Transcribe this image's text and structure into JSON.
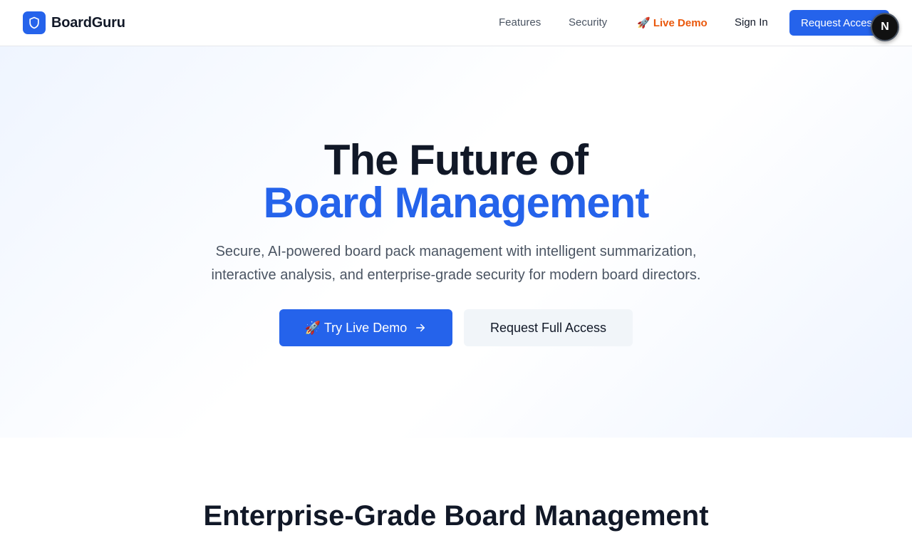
{
  "nav": {
    "brand": "BoardGuru",
    "links": {
      "features": "Features",
      "security": "Security",
      "live_demo": "🚀 Live Demo",
      "sign_in": "Sign In"
    },
    "request_access": "Request Access",
    "floating_badge": "N"
  },
  "hero": {
    "title_line1": "The Future of",
    "title_line2": "Board Management",
    "subtitle_line1": "Secure, AI-powered board pack management with intelligent summarization,",
    "subtitle_line2": "interactive analysis, and enterprise-grade security for modern board directors.",
    "primary_cta": "🚀 Try Live Demo",
    "secondary_cta": "Request Full Access"
  },
  "next_section": {
    "heading": "Enterprise-Grade Board Management"
  },
  "colors": {
    "brand": "#2563eb",
    "demo_accent": "#ea580c",
    "text_dark": "#111827",
    "text_muted": "#4b5563"
  },
  "icons": {
    "logo": "shield-icon",
    "cta_arrow": "arrow-right-icon"
  }
}
